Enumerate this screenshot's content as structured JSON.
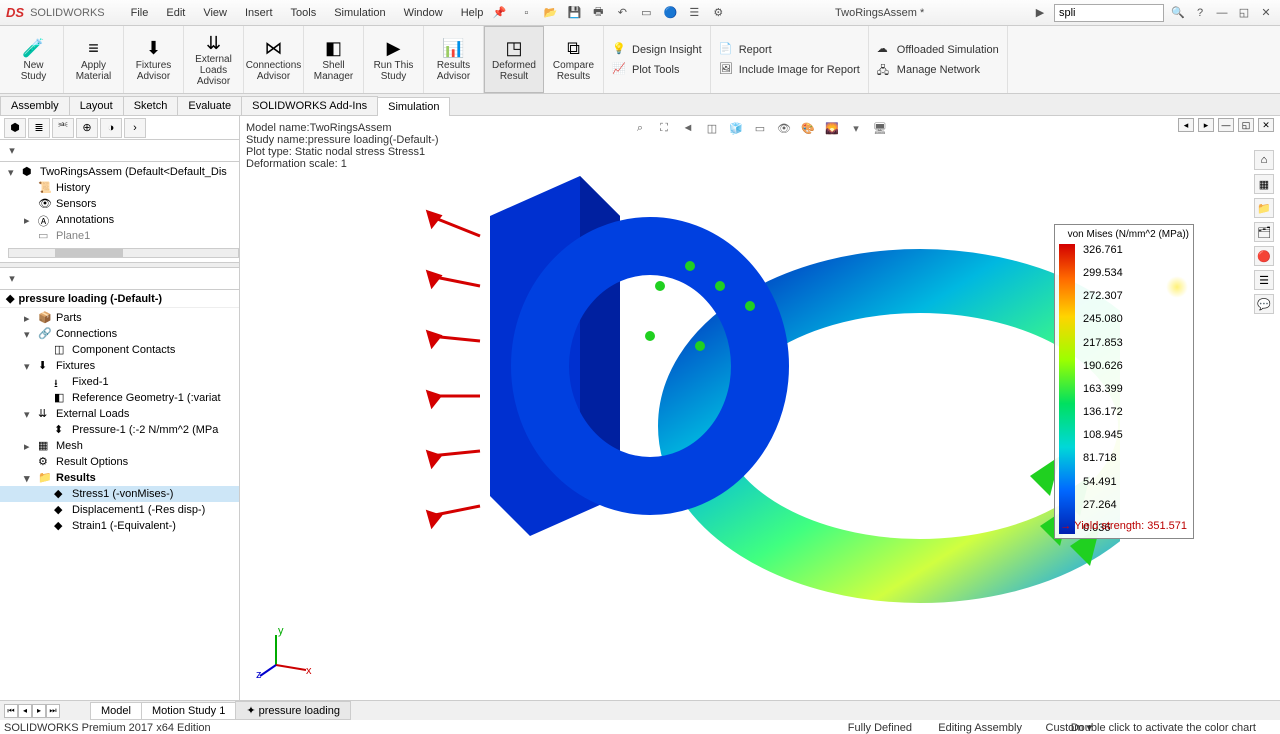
{
  "title": {
    "app": "SOLIDWORKS",
    "doc": "TwoRingsAssem *"
  },
  "menu": [
    "File",
    "Edit",
    "View",
    "Insert",
    "Tools",
    "Simulation",
    "Window",
    "Help"
  ],
  "search": {
    "value": "spli"
  },
  "ribbon": {
    "big": [
      {
        "label": "New\nStudy",
        "icon": "🧪"
      },
      {
        "label": "Apply\nMaterial",
        "icon": "≡"
      },
      {
        "label": "Fixtures\nAdvisor",
        "icon": "⬇"
      },
      {
        "label": "External Loads\nAdvisor",
        "icon": "⇊"
      },
      {
        "label": "Connections\nAdvisor",
        "icon": "⋈"
      },
      {
        "label": "Shell\nManager",
        "icon": "◧"
      },
      {
        "label": "Run This\nStudy",
        "icon": "▶"
      },
      {
        "label": "Results\nAdvisor",
        "icon": "📊"
      },
      {
        "label": "Deformed\nResult",
        "icon": "◳",
        "active": true
      },
      {
        "label": "Compare\nResults",
        "icon": "⧉"
      }
    ],
    "stacks": [
      [
        {
          "icon": "💡",
          "label": "Design Insight"
        },
        {
          "icon": "📈",
          "label": "Plot Tools"
        }
      ],
      [
        {
          "icon": "📄",
          "label": "Report"
        },
        {
          "icon": "🖼",
          "label": "Include Image for Report"
        }
      ],
      [
        {
          "icon": "☁",
          "label": "Offloaded Simulation"
        },
        {
          "icon": "🖧",
          "label": "Manage Network"
        }
      ]
    ]
  },
  "tabs": [
    "Assembly",
    "Layout",
    "Sketch",
    "Evaluate",
    "SOLIDWORKS Add-Ins",
    "Simulation"
  ],
  "active_tab": "Simulation",
  "info": {
    "l1": "Model name:TwoRingsAssem",
    "l2": "Study name:pressure loading(-Default-)",
    "l3": "Plot type: Static nodal stress Stress1",
    "l4": "Deformation scale: 1"
  },
  "feature_tree": {
    "root": "TwoRingsAssem  (Default<Default_Dis",
    "items": [
      "History",
      "Sensors",
      "Annotations",
      "Plane1"
    ]
  },
  "study": {
    "name": "pressure loading (-Default-)",
    "nodes": [
      {
        "label": "Parts",
        "icon": "📦",
        "ind": 1,
        "exp": "▸"
      },
      {
        "label": "Connections",
        "icon": "🔗",
        "ind": 1,
        "exp": "▾"
      },
      {
        "label": "Component Contacts",
        "icon": "◫",
        "ind": 2,
        "exp": ""
      },
      {
        "label": "Fixtures",
        "icon": "⬇",
        "ind": 1,
        "exp": "▾"
      },
      {
        "label": "Fixed-1",
        "icon": "⭳",
        "ind": 2,
        "exp": ""
      },
      {
        "label": "Reference Geometry-1 (:variat",
        "icon": "◧",
        "ind": 2,
        "exp": ""
      },
      {
        "label": "External Loads",
        "icon": "⇊",
        "ind": 1,
        "exp": "▾"
      },
      {
        "label": "Pressure-1 (:-2 N/mm^2 (MPa",
        "icon": "⬍",
        "ind": 2,
        "exp": ""
      },
      {
        "label": "Mesh",
        "icon": "▦",
        "ind": 1,
        "exp": "▸"
      },
      {
        "label": "Result Options",
        "icon": "⚙",
        "ind": 1,
        "exp": ""
      },
      {
        "label": "Results",
        "icon": "📁",
        "ind": 1,
        "exp": "▾",
        "bold": true
      },
      {
        "label": "Stress1 (-vonMises-)",
        "icon": "◆",
        "ind": 2,
        "exp": "",
        "sel": true
      },
      {
        "label": "Displacement1 (-Res disp-)",
        "icon": "◆",
        "ind": 2,
        "exp": ""
      },
      {
        "label": "Strain1 (-Equivalent-)",
        "icon": "◆",
        "ind": 2,
        "exp": ""
      }
    ]
  },
  "legend": {
    "title": "von Mises (N/mm^2 (MPa))",
    "ticks": [
      "326.761",
      "299.534",
      "272.307",
      "245.080",
      "217.853",
      "190.626",
      "163.399",
      "136.172",
      "108.945",
      "81.718",
      "54.491",
      "27.264",
      "0.036"
    ],
    "yield": "Yield strength: 351.571"
  },
  "bottom_tabs": [
    "Model",
    "Motion Study 1",
    "pressure loading"
  ],
  "bottom_active": "pressure loading",
  "status": {
    "edition": "SOLIDWORKS Premium 2017 x64 Edition",
    "s1": "Fully Defined",
    "s2": "Editing Assembly",
    "s3": "Custom  ▾",
    "hint": "Double click to activate the color chart"
  },
  "triad": {
    "x": "x",
    "y": "y",
    "z": "z"
  }
}
